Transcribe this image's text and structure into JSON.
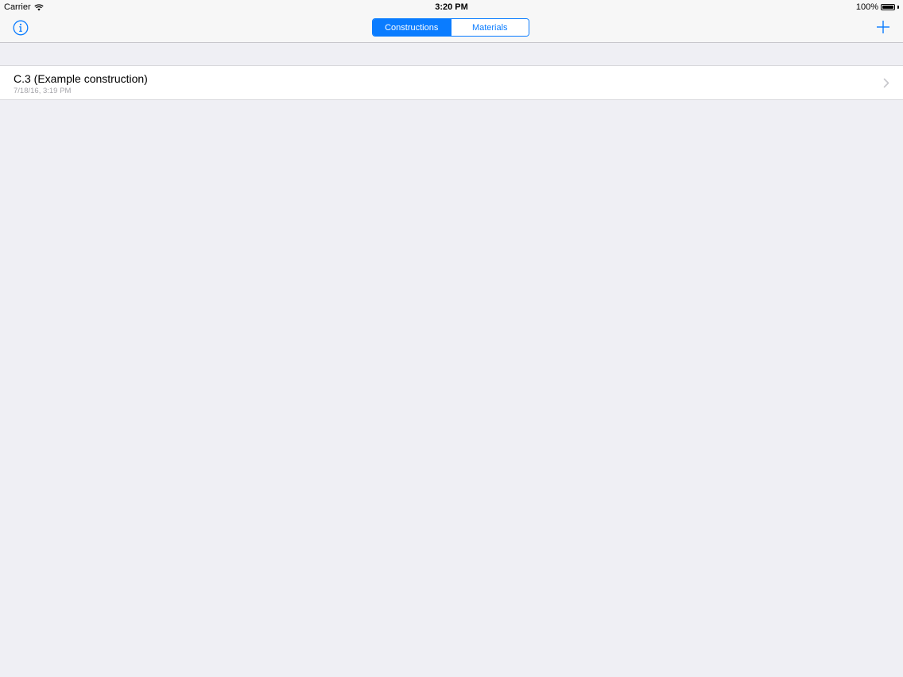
{
  "status_bar": {
    "carrier": "Carrier",
    "time": "3:20 PM",
    "battery_percent": "100%",
    "battery_level": 1.0
  },
  "nav_bar": {
    "info_icon": "info-circle-icon",
    "add_icon": "plus-icon",
    "tint_color": "#0a7cff",
    "segments": [
      {
        "label": "Constructions",
        "selected": true
      },
      {
        "label": "Materials",
        "selected": false
      }
    ]
  },
  "list": {
    "items": [
      {
        "title": "C.3 (Example construction)",
        "subtitle": "7/18/16, 3:19 PM"
      }
    ]
  }
}
